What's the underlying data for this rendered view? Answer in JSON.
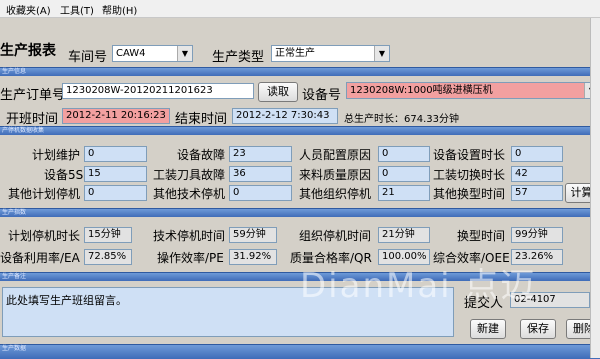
{
  "menu": {
    "favorites": "收藏夹(A)",
    "tools": "工具(T)",
    "help": "帮助(H)"
  },
  "header": {
    "title": "生产报表",
    "workshop_label": "车间号",
    "workshop_value": "CAW4",
    "type_label": "生产类型",
    "type_value": "正常生产"
  },
  "sections": {
    "order_info": "生产信息",
    "downtime": "产停机数据收集",
    "indicators": "生产指数",
    "remarks": "生产备注",
    "bottom": "生产数据"
  },
  "order": {
    "order_label": "生产订单号",
    "order_value": "1230208W-20120211201623",
    "read_button": "读取",
    "device_label": "设备号",
    "device_value": "1230208W:1000吨级进横压机",
    "start_label": "开班时间",
    "start_value": "2012-2-11 20:16:23",
    "end_label": "结束时间",
    "end_value": "2012-2-12 7:30:43",
    "total_label": "总生产时长：",
    "total_value": "674.33分钟"
  },
  "downtime": {
    "rows": [
      [
        {
          "label": "计划维护",
          "value": "0"
        },
        {
          "label": "设备故障",
          "value": "23"
        },
        {
          "label": "人员配置原因",
          "value": "0"
        },
        {
          "label": "设备设置时长",
          "value": "0"
        }
      ],
      [
        {
          "label": "设备5S",
          "value": "15"
        },
        {
          "label": "工装刀具故障",
          "value": "36"
        },
        {
          "label": "来料质量原因",
          "value": "0"
        },
        {
          "label": "工装切换时长",
          "value": "42"
        }
      ],
      [
        {
          "label": "其他计划停机",
          "value": "0"
        },
        {
          "label": "其他技术停机",
          "value": "0"
        },
        {
          "label": "其他组织停机",
          "value": "21"
        },
        {
          "label": "其他换型时间",
          "value": "57"
        }
      ]
    ],
    "calc_button": "计算"
  },
  "indicators": {
    "rows": [
      [
        {
          "label": "计划停机时长",
          "value": "15分钟"
        },
        {
          "label": "技术停机时间",
          "value": "59分钟"
        },
        {
          "label": "组织停机时间",
          "value": "21分钟"
        },
        {
          "label": "换型时间",
          "value": "99分钟"
        }
      ],
      [
        {
          "label": "设备利用率/EA",
          "value": "72.85%"
        },
        {
          "label": "操作效率/PE",
          "value": "31.92%"
        },
        {
          "label": "质量合格率/QR",
          "value": "100.00%"
        },
        {
          "label": "综合效率/OEE",
          "value": "23.26%"
        }
      ]
    ]
  },
  "remarks": {
    "text": "此处填写生产班组留言。",
    "submitter_label": "提交人",
    "submitter_value": "02-4107",
    "new_button": "新建",
    "save_button": "保存",
    "delete_button": "删除"
  },
  "watermark": "DianMai 点迈"
}
